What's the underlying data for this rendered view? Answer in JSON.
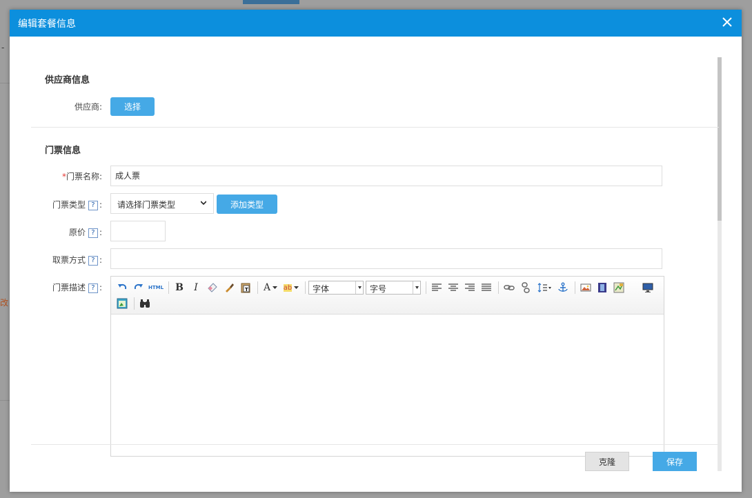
{
  "background": {
    "side_text": "改",
    "dash": "-"
  },
  "dialog": {
    "title": "编辑套餐信息"
  },
  "supplier_section": {
    "title": "供应商信息",
    "supplier_label": "供应商:",
    "select_button": "选择"
  },
  "ticket_section": {
    "title": "门票信息",
    "required_mark": "*",
    "name_label": "门票名称:",
    "name_value": "成人票",
    "type_label": "门票类型",
    "type_select_value": "请选择门票类型",
    "add_type_button": "添加类型",
    "price_label": "原价",
    "price_value": "",
    "pickup_label": "取票方式",
    "pickup_value": "",
    "desc_label": "门票描述",
    "help_glyph": "?",
    "colon": ":"
  },
  "editor": {
    "html_label": "HTML",
    "font_family": "字体",
    "font_size": "字号",
    "bold_glyph": "B",
    "italic_glyph": "I",
    "text_color_glyph": "A",
    "highlight_glyph": "ab",
    "content": ""
  },
  "footer": {
    "clone_button": "克隆",
    "save_button": "保存"
  },
  "colors": {
    "header": "#0c8fdd",
    "primary_button": "#45a9e6",
    "required": "#e53935"
  }
}
